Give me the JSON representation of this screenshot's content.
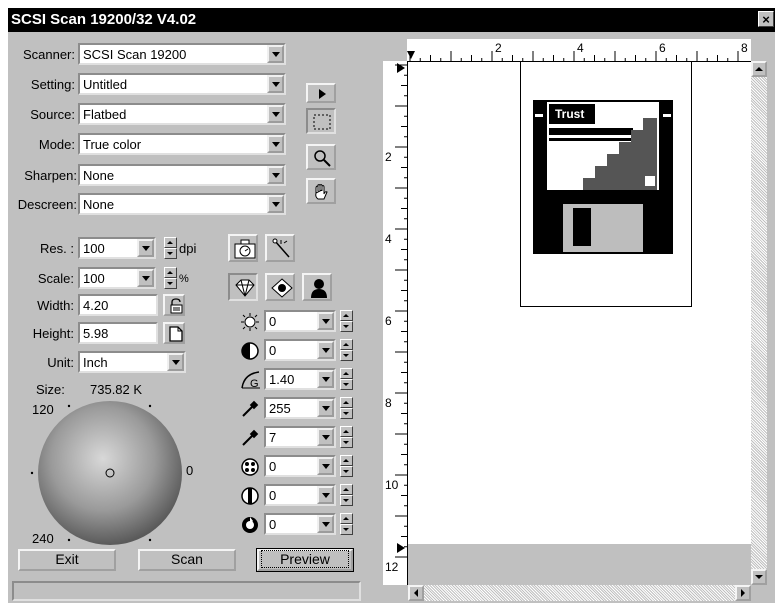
{
  "window": {
    "title": "SCSI Scan 19200/32 V4.02",
    "close": "×"
  },
  "settings": {
    "scanner": {
      "label": "Scanner:",
      "value": "SCSI Scan 19200"
    },
    "setting": {
      "label": "Setting:",
      "value": "Untitled"
    },
    "source": {
      "label": "Source:",
      "value": "Flatbed"
    },
    "mode": {
      "label": "Mode:",
      "value": "True color"
    },
    "sharpen": {
      "label": "Sharpen:",
      "value": "None"
    },
    "descreen": {
      "label": "Descreen:",
      "value": "None"
    }
  },
  "resolution": {
    "label": "Res. :",
    "value": "100",
    "unit": "dpi"
  },
  "scale": {
    "label": "Scale:",
    "value": "100",
    "unit": "%"
  },
  "width": {
    "label": "Width:",
    "value": "4.20"
  },
  "height": {
    "label": "Height:",
    "value": "5.98"
  },
  "unit": {
    "label": "Unit:",
    "value": "Inch"
  },
  "size": {
    "label": "Size:",
    "value": "735.82  K"
  },
  "wheel": {
    "top": "120",
    "right": "0",
    "bottom": "240"
  },
  "adjustments": {
    "brightness": "0",
    "contrast": "0",
    "gamma": "1.40",
    "highlight": "255",
    "shadow": "7",
    "saturation": "0",
    "tone": "0",
    "hue": "0"
  },
  "buttons": {
    "exit": "Exit",
    "scan": "Scan",
    "preview": "Preview"
  },
  "ruler": {
    "h_labels": [
      "2",
      "4",
      "6",
      "8"
    ],
    "v_labels": [
      "2",
      "4",
      "6",
      "8",
      "10",
      "12"
    ]
  },
  "preview_logo": "Trust"
}
